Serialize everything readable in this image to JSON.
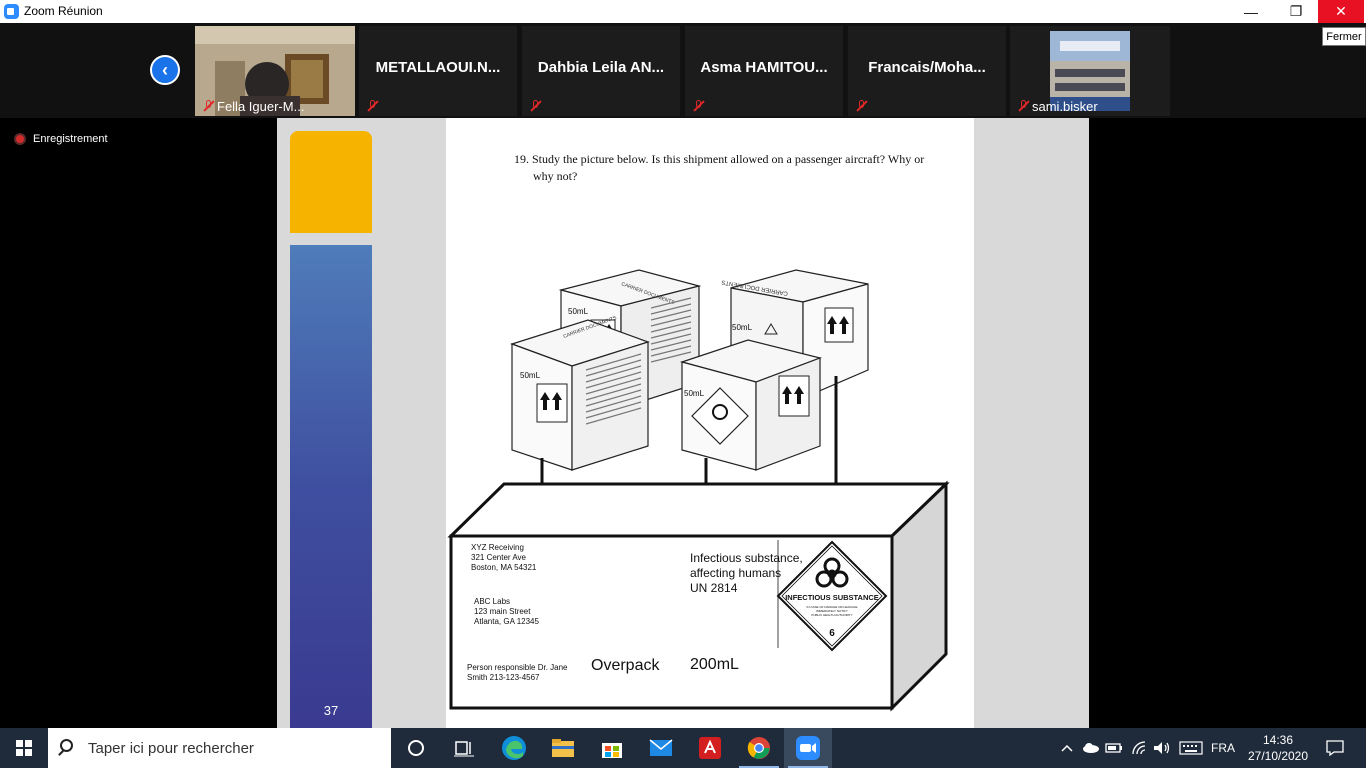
{
  "window": {
    "title": "Zoom Réunion",
    "close_tooltip": "Fermer",
    "minimize_glyph": "—",
    "restore_glyph": "❐",
    "close_glyph": "✕"
  },
  "gallery": {
    "prev_glyph": "‹",
    "participants": [
      {
        "name": "Fella Iguer-M...",
        "type": "video"
      },
      {
        "name": "METALLAOUI.N...",
        "type": "name"
      },
      {
        "name": "Dahbia  Leila  AN...",
        "type": "name"
      },
      {
        "name": "Asma  HAMITOU...",
        "type": "name"
      },
      {
        "name": "Francais/Moha...",
        "type": "name"
      },
      {
        "name": "sami.bisker",
        "type": "video"
      }
    ]
  },
  "recording": {
    "label": "Enregistrement"
  },
  "slide": {
    "page_number": "37",
    "question_line1": "19.  Study the picture below. Is this shipment allowed on a passenger aircraft? Why or",
    "question_line2": "why not?",
    "box_volume": "50mL",
    "carrier_docs": "CARRIER DOCUMENTS",
    "receiver": [
      "XYZ Receiving",
      "321 Center Ave",
      "Boston, MA 54321"
    ],
    "sender": [
      "ABC Labs",
      "123 main Street",
      "Atlanta, GA 12345"
    ],
    "person": [
      "Person responsible Dr. Jane",
      "Smith 213-123-4567"
    ],
    "hazard_text": [
      "Infectious substance,",
      "affecting humans",
      "UN 2814"
    ],
    "diamond_label": "INFECTIOUS SUBSTANCE",
    "diamond_fine": [
      "IN CASE OF DAMAGE OR LEAKAGE",
      "IMMEDIATELY NOTIFY",
      "PUBLIC HEALTH AUTHORITY"
    ],
    "diamond_class": "6",
    "overpack_label": "Overpack",
    "overpack_volume": "200mL"
  },
  "taskbar": {
    "search_placeholder": "Taper ici pour rechercher",
    "language": "FRA",
    "time": "14:36",
    "date": "27/10/2020"
  },
  "colors": {
    "zoom_blue": "#2d8cff",
    "close_red": "#e81123",
    "slide_yellow": "#f6b400",
    "slide_blue": "#4f7cba",
    "taskbar": "#1f2b3a"
  }
}
